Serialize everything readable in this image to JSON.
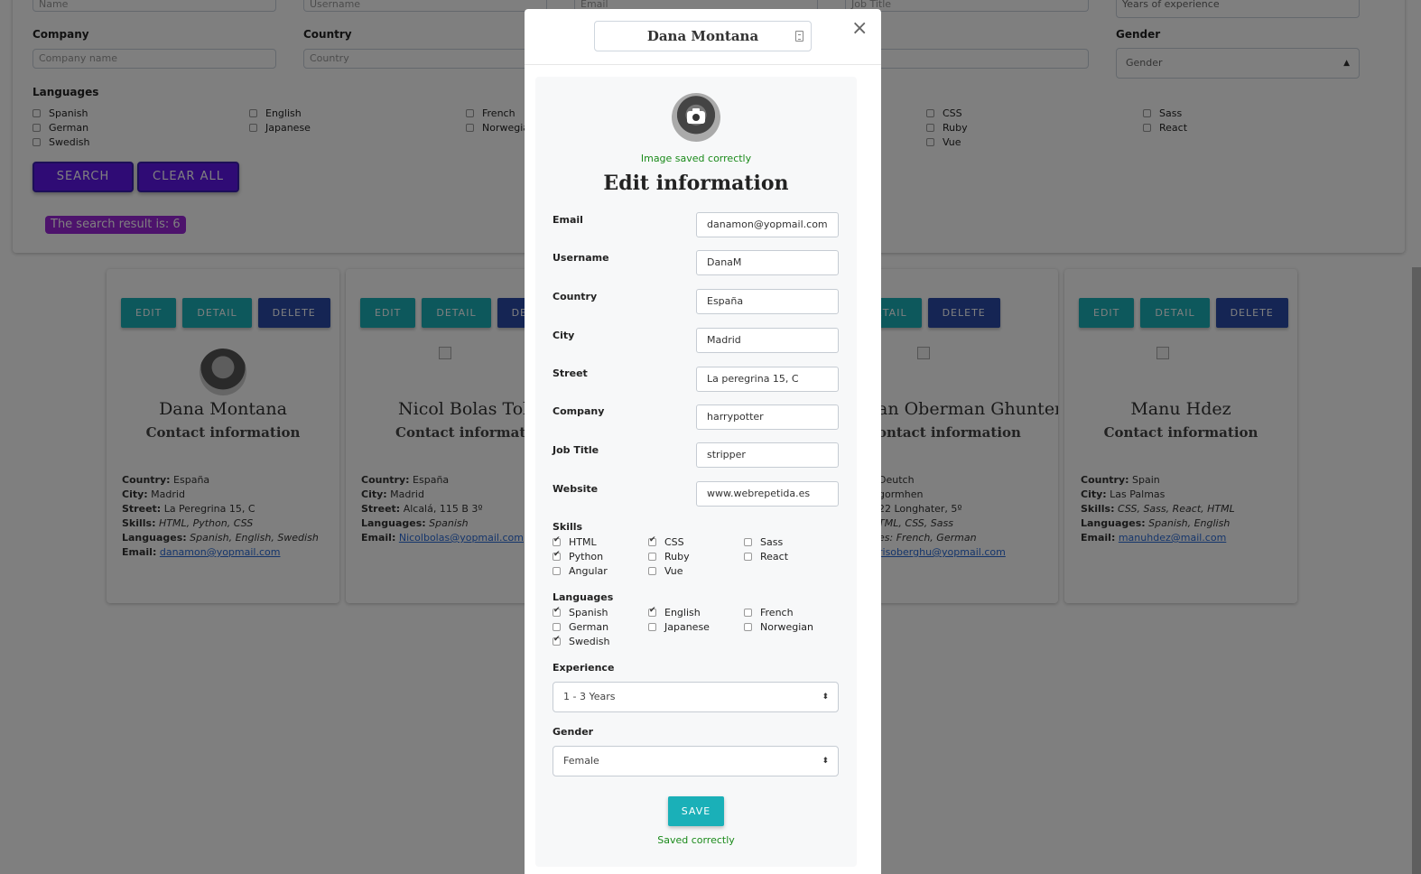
{
  "filters": {
    "top_placeholders": [
      "Name",
      "Username",
      "Email",
      "Job Title"
    ],
    "experience_placeholder": "Years of experience",
    "company_label": "Company",
    "company_placeholder": "Company name",
    "country_label": "Country",
    "country_placeholder": "Country",
    "gender_label": "Gender",
    "gender_placeholder": "Gender",
    "languages_label": "Languages",
    "language_options": [
      "Spanish",
      "German",
      "Swedish",
      "English",
      "Japanese",
      "French",
      "Norwegian"
    ],
    "skill_options": [
      "CSS",
      "Ruby",
      "Vue",
      "Sass",
      "React"
    ],
    "search_button": "SEARCH",
    "clear_button": "CLEAR ALL",
    "result_text": "The search result is: 6"
  },
  "card_buttons": {
    "edit": "EDIT",
    "detail": "DETAIL",
    "delete": "DELETE"
  },
  "cards": [
    {
      "name": "Dana Montana",
      "subtitle": "Contact information",
      "country": "España",
      "city": "Madrid",
      "street": "La Peregrina 15, C",
      "skills": "HTML, Python, CSS",
      "languages": "Spanish, English, Swedish",
      "email": "danamon@yopmail.com"
    },
    {
      "name": "Nicol Bolas Tol",
      "subtitle": "Contact information",
      "country": "España",
      "city": "Madrid",
      "street": "Alcalá, 115 B 3º",
      "languages": "Spanish",
      "email": "Nicolbolas@yopmail.com"
    },
    {
      "name": "an Oberman Ghunter",
      "subtitle": "ontact information",
      "country": "Deutch",
      "city": "gormhen",
      "street": "22 Longhater, 5º",
      "skills": "TML, CSS, Sass",
      "languages": "es: French, German",
      "email": "risoberghu@yopmail.com"
    },
    {
      "name": "Manu Hdez",
      "subtitle": "Contact information",
      "country": "Spain",
      "city": "Las Palmas",
      "skills": "CSS, Sass, React, HTML",
      "languages": "Spanish, English",
      "email": "manuhdez@mail.com"
    }
  ],
  "info_labels": {
    "country": "Country:",
    "city": "City:",
    "street": "Street:",
    "skills": "Skills:",
    "languages": "Languages:",
    "email": "Email:"
  },
  "modal": {
    "header_name": "Dana Montana",
    "close_symbol": "×",
    "image_status": "Image saved correctly",
    "title": "Edit information",
    "fields": [
      {
        "label": "Email",
        "value": "danamon@yopmail.com"
      },
      {
        "label": "Username",
        "value": "DanaM"
      },
      {
        "label": "Country",
        "value": "España"
      },
      {
        "label": "City",
        "value": "Madrid"
      },
      {
        "label": "Street",
        "value": "La peregrina 15, C"
      },
      {
        "label": "Company",
        "value": "harrypotter"
      },
      {
        "label": "Job Title",
        "value": "stripper"
      },
      {
        "label": "Website",
        "value": "www.webrepetida.es"
      }
    ],
    "skills_label": "Skills",
    "skills": [
      {
        "label": "HTML",
        "checked": true
      },
      {
        "label": "CSS",
        "checked": true
      },
      {
        "label": "Sass",
        "checked": false
      },
      {
        "label": "Python",
        "checked": true
      },
      {
        "label": "Ruby",
        "checked": false
      },
      {
        "label": "React",
        "checked": false
      },
      {
        "label": "Angular",
        "checked": false
      },
      {
        "label": "Vue",
        "checked": false
      }
    ],
    "languages_label": "Languages",
    "languages": [
      {
        "label": "Spanish",
        "checked": true
      },
      {
        "label": "English",
        "checked": true
      },
      {
        "label": "French",
        "checked": false
      },
      {
        "label": "German",
        "checked": false
      },
      {
        "label": "Japanese",
        "checked": false
      },
      {
        "label": "Norwegian",
        "checked": false
      },
      {
        "label": "Swedish",
        "checked": true
      }
    ],
    "experience_label": "Experience",
    "experience_value": "1 - 3 Years",
    "gender_label": "Gender",
    "gender_value": "Female",
    "save_button": "SAVE",
    "save_status": "Saved correctly"
  },
  "colors": {
    "teal": "#1ab0b8",
    "navy": "#2a4aa8",
    "purple": "#5e17eb",
    "badge": "#9b26d9",
    "success": "#1a8a1a"
  }
}
